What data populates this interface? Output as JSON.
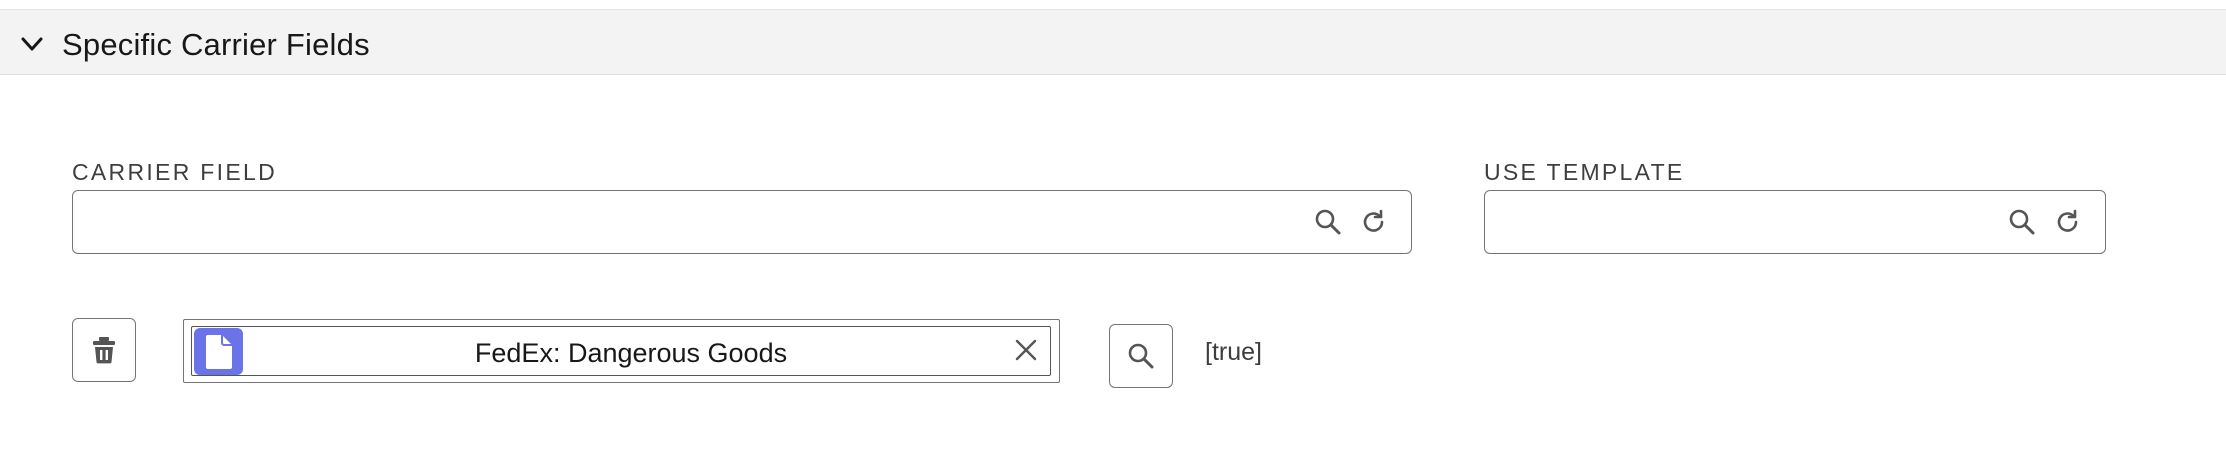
{
  "section": {
    "title": "Specific Carrier Fields",
    "expanded": true
  },
  "carrier_field": {
    "label": "CARRIER FIELD",
    "value": "",
    "search_icon": "search-icon",
    "refresh_icon": "refresh-icon"
  },
  "use_template": {
    "label": "USE TEMPLATE",
    "value": "",
    "search_icon": "search-icon",
    "refresh_icon": "refresh-icon"
  },
  "row": {
    "delete_icon": "trash-icon",
    "selected_record": "FedEx: Dangerous Goods",
    "record_icon": "document-icon",
    "remove_icon": "close-icon",
    "lookup_icon": "search-icon",
    "value": "[true]"
  },
  "colors": {
    "header_bg": "#f3f3f3",
    "border": "#747474",
    "record_icon_bg": "#6a74e8",
    "text": "#181818",
    "label_text": "#3e3e3c"
  }
}
